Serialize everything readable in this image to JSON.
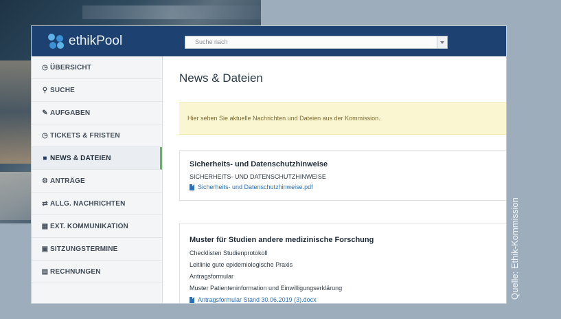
{
  "app": {
    "logo_text": "ethikPool"
  },
  "search": {
    "placeholder": "Suche nach"
  },
  "sidebar": {
    "items": [
      {
        "label": "ÜBERSICHT",
        "icon": "clock-icon"
      },
      {
        "label": "SUCHE",
        "icon": "search-icon"
      },
      {
        "label": "AUFGABEN",
        "icon": "edit-icon"
      },
      {
        "label": "TICKETS & FRISTEN",
        "icon": "clock-icon"
      },
      {
        "label": "NEWS & DATEIEN",
        "icon": "comment-icon",
        "active": true
      },
      {
        "label": "ANTRÄGE",
        "icon": "gear-icon"
      },
      {
        "label": "ALLG. NACHRICHTEN",
        "icon": "exchange-icon"
      },
      {
        "label": "EXT. KOMMUNIKATION",
        "icon": "building-icon"
      },
      {
        "label": "SITZUNGSTERMINE",
        "icon": "calendar-icon"
      },
      {
        "label": "RECHNUNGEN",
        "icon": "invoice-icon"
      }
    ]
  },
  "main": {
    "title": "News & Dateien",
    "notice": "Hier sehen Sie aktuelle Nachrichten und Dateien aus der Kommission.",
    "cards": [
      {
        "title": "Sicherheits- und Datenschutzhinweise",
        "lines": [
          "SICHERHEITS- UND DATENSCHUTZHINWEISE"
        ],
        "files": [
          "Sicherheits- und Datenschutzhinweise.pdf"
        ]
      },
      {
        "title": "Muster für Studien andere medizinische Forschung",
        "lines": [
          "Checklisten Studienprotokoll",
          "Leitlinie gute epidemiologische Praxis",
          "Antragsformular",
          "Muster Patienteninformation und Einwilligungserklärung"
        ],
        "files": [
          "Antragsformular Stand 30.06.2019 (3).docx"
        ]
      }
    ]
  },
  "credit": "Quelle: Ethik-Kommission",
  "colors": {
    "topbar": "#1d4271",
    "active_indicator": "#5cb85c",
    "link": "#2f6fb3",
    "notice_bg": "#fbf6d2"
  }
}
